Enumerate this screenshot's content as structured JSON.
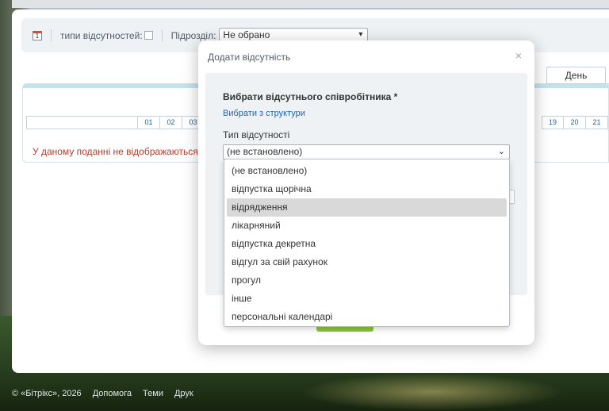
{
  "toolbar": {
    "absence_types_label": "типи відсутностей:",
    "department_label": "Підрозділ:",
    "department_value": "Не обрано"
  },
  "calendar": {
    "day_tab": "День",
    "dates_left": [
      "01",
      "02",
      "03"
    ],
    "dates_right": [
      "19",
      "20",
      "21"
    ],
    "warning": "У даному поданні не відображаються від"
  },
  "footer": {
    "copyright": "© «Бітрікс», 2026",
    "help": "Допомога",
    "themes": "Теми",
    "print": "Друк"
  },
  "modal": {
    "title": "Додати відсутність",
    "close_symbol": "×",
    "employee_label": "Вибрати відсутнього співробітника *",
    "choose_from_structure": "Вибрати з структури",
    "absence_type_label": "Тип відсутності",
    "absence_type_value": "(не встановлено)",
    "options": [
      "(не встановлено)",
      "відпустка щорічна",
      "відрядження",
      "лікарняний",
      "відпустка декретна",
      "відгул за свій рахунок",
      "прогул",
      "інше",
      "персональні календарі"
    ],
    "highlighted_option": "відрядження"
  },
  "icons": {
    "calendar": "calendar-icon",
    "close": "close-icon",
    "chevron": "chevron-down-icon"
  },
  "colors": {
    "link": "#2067b0",
    "warning": "#c0392b",
    "save_button": "#8cc63a",
    "highlight": "#d9d9d9"
  }
}
